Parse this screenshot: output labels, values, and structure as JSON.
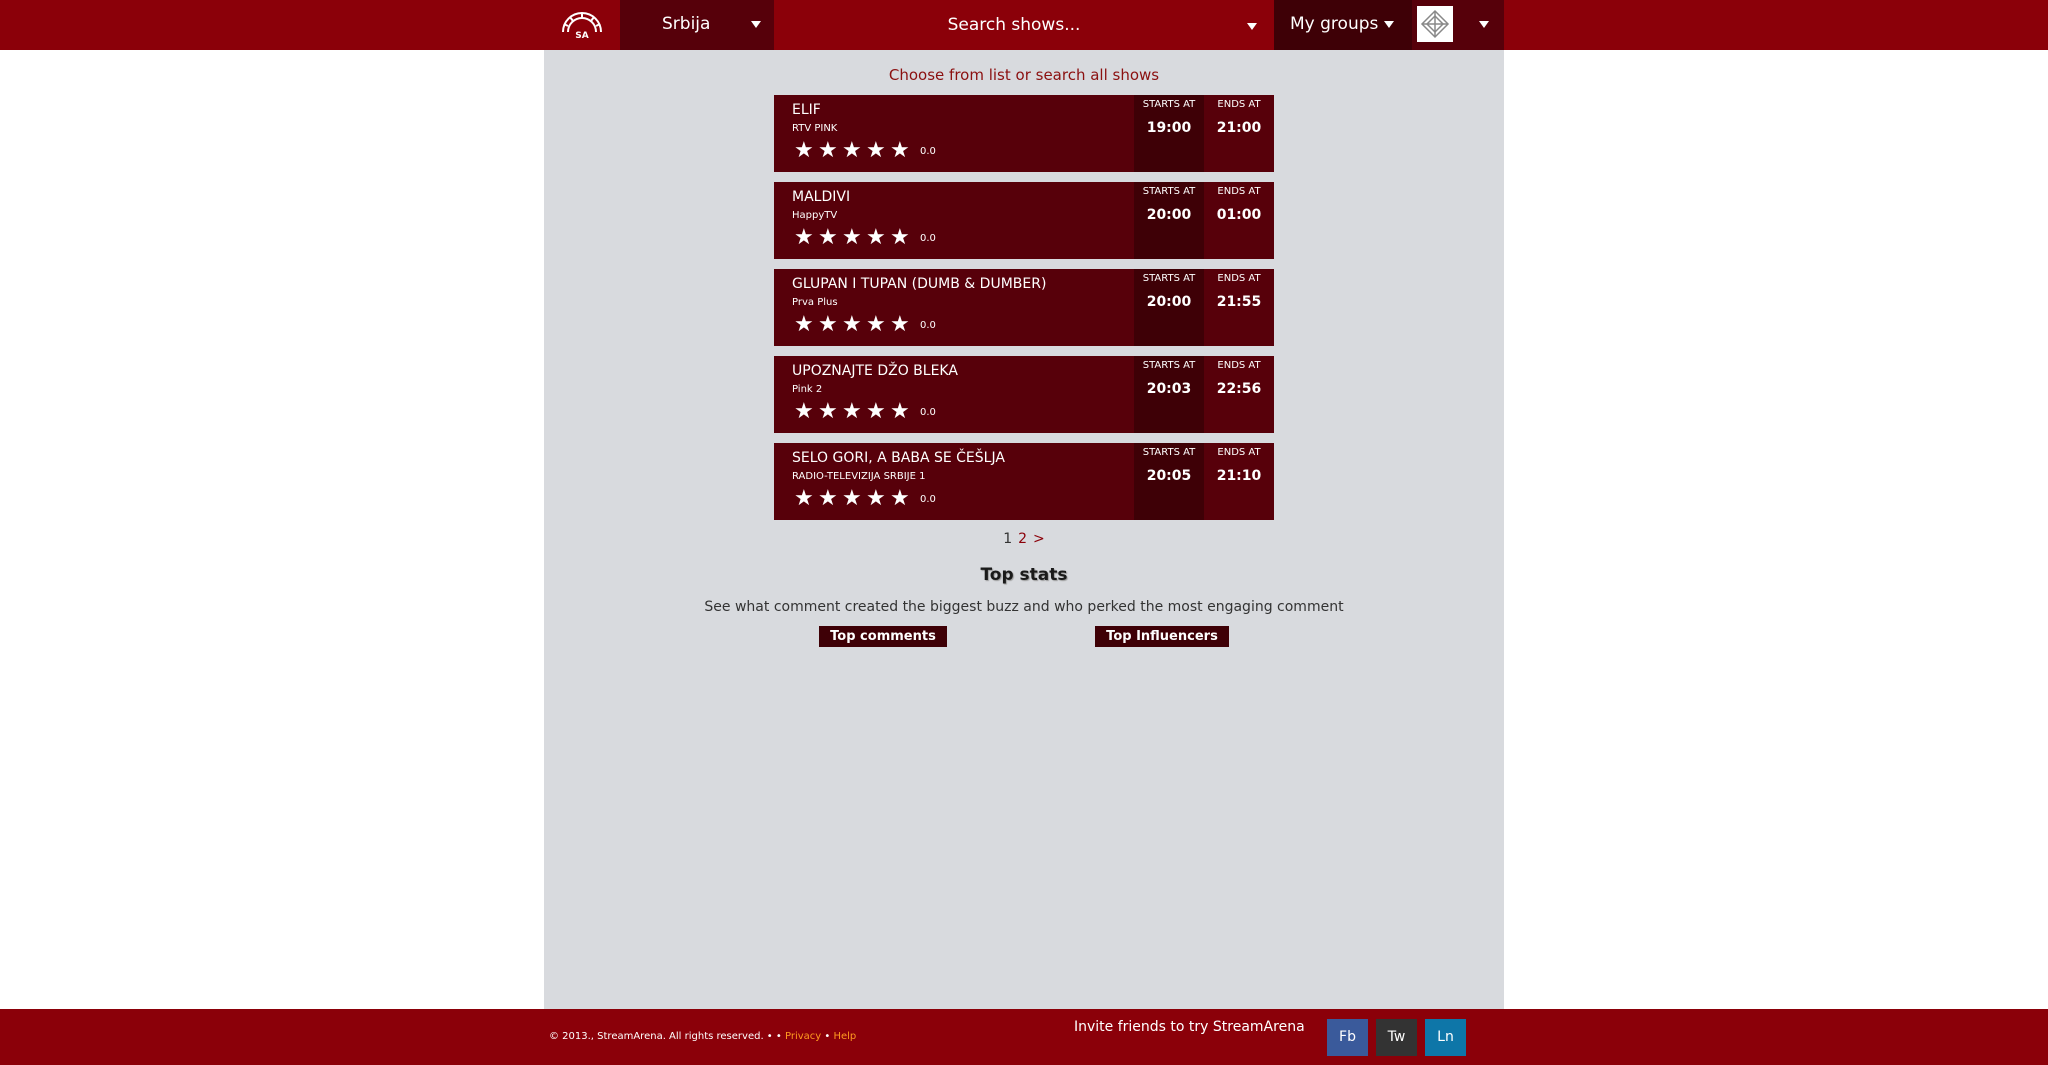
{
  "header": {
    "logo_text": "SA",
    "country": "Srbija",
    "search_placeholder": "Search shows...",
    "my_groups": "My groups"
  },
  "main": {
    "choose_text": "Choose from list or search all shows",
    "starts_label": "STARTS AT",
    "ends_label": "ENDS AT",
    "shows": [
      {
        "title": "ELIF",
        "channel": "RTV PINK",
        "rating": "0.0",
        "starts": "19:00",
        "ends": "21:00"
      },
      {
        "title": "MALDIVI",
        "channel": "HappyTV",
        "rating": "0.0",
        "starts": "20:00",
        "ends": "01:00"
      },
      {
        "title": "GLUPAN I TUPAN (DUMB & DUMBER)",
        "channel": "Prva Plus",
        "rating": "0.0",
        "starts": "20:00",
        "ends": "21:55"
      },
      {
        "title": "UPOZNAJTE DŽO BLEKA",
        "channel": "Pink 2",
        "rating": "0.0",
        "starts": "20:03",
        "ends": "22:56"
      },
      {
        "title": "SELO GORI, A BABA SE ČEŠLJA",
        "channel": "RADIO-TELEVIZIJA SRBIJE 1",
        "rating": "0.0",
        "starts": "20:05",
        "ends": "21:10"
      }
    ],
    "pager": {
      "current": "1",
      "next_page": "2",
      "next": ">"
    },
    "top_stats": {
      "title": "Top stats",
      "description": "See what comment created the biggest buzz and who perked the most engaging comment",
      "top_comments": "Top comments",
      "top_influencers": "Top Influencers"
    }
  },
  "footer": {
    "copyright": "© 2013., StreamArena. All rights reserved. • •",
    "privacy": "Privacy",
    "separator": "•",
    "help": "Help",
    "invite": "Invite friends to try StreamArena",
    "fb": "Fb",
    "tw": "Tw",
    "ln": "Ln"
  },
  "colors": {
    "brand_red": "#8b0009",
    "dark_red": "#56000a",
    "darker_red": "#3e0006",
    "content_bg": "#d8dade",
    "facebook": "#3a5a9b",
    "twitter": "#333333",
    "linkedin": "#0e76a8",
    "link_orange": "#ff9a20"
  },
  "icons": {
    "logo": "streamarena-logo-icon",
    "star": "star-icon",
    "caret": "caret-down-icon",
    "avatar": "user-avatar-icon"
  }
}
